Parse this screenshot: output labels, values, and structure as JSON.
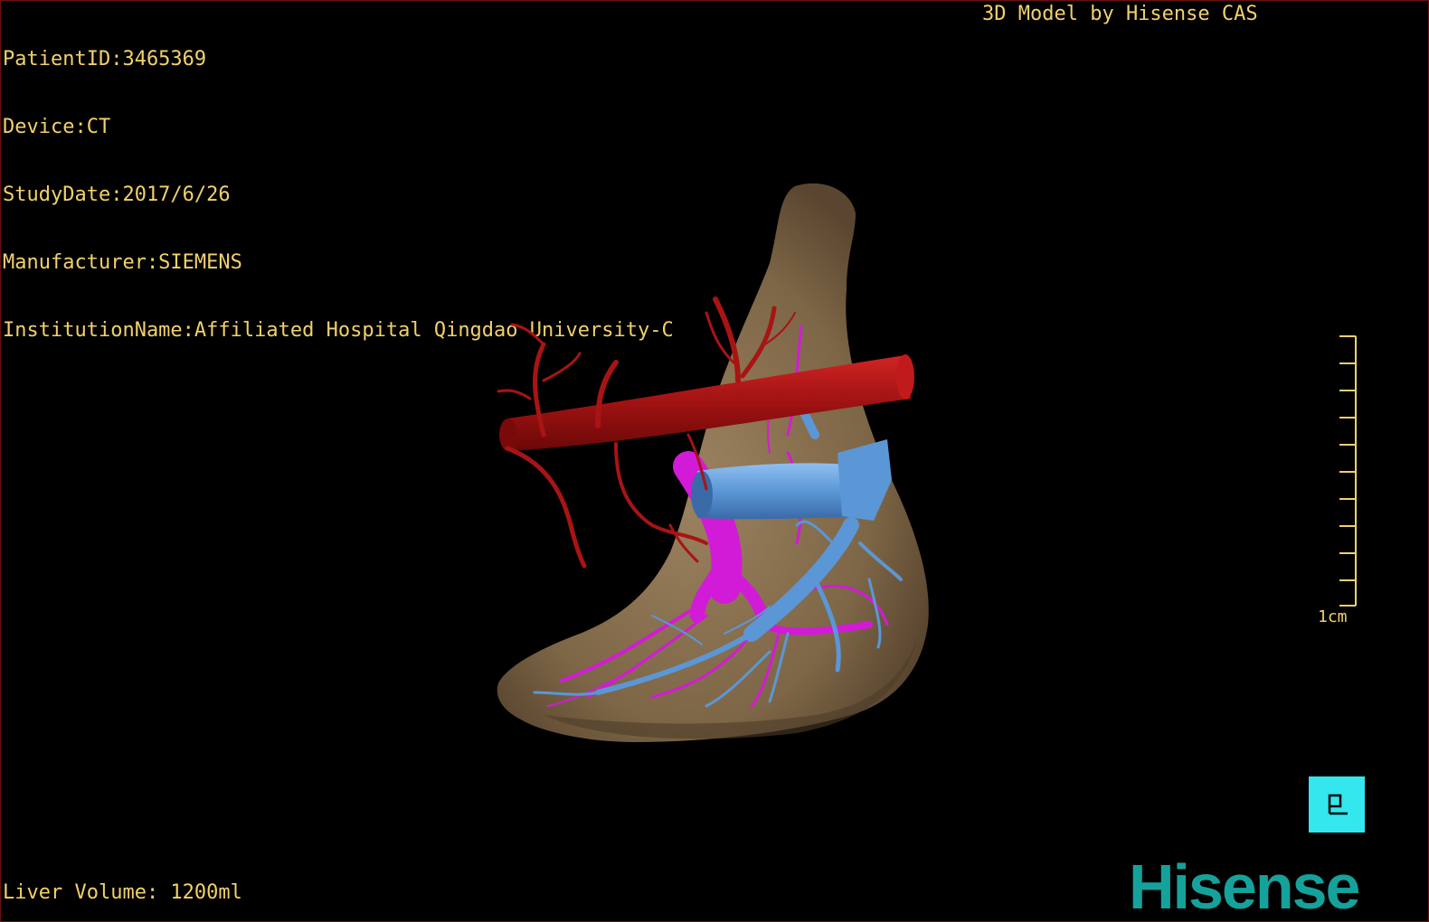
{
  "patient_info": {
    "patient_id": "PatientID:3465369",
    "device": "Device:CT",
    "study_date": "StudyDate:2017/6/26",
    "manufacturer": "Manufacturer:SIEMENS",
    "institution": "InstitutionName:Affiliated Hospital Qingdao University-C"
  },
  "credit": "3D Model by Hisense CAS",
  "scale": {
    "label": "1cm"
  },
  "volume": "Liver Volume: 1200ml",
  "orientation": {
    "label": "P",
    "icon": "orientation-cube-icon"
  },
  "logo": "Hisense",
  "colors": {
    "overlay_text": "#f2d16b",
    "liver": "#8a7152",
    "artery": "#b01515",
    "portal_vein": "#d21bd6",
    "hepatic_vein": "#5b97d6",
    "orientation_bg": "#34e6ee",
    "logo": "#15a29b"
  }
}
